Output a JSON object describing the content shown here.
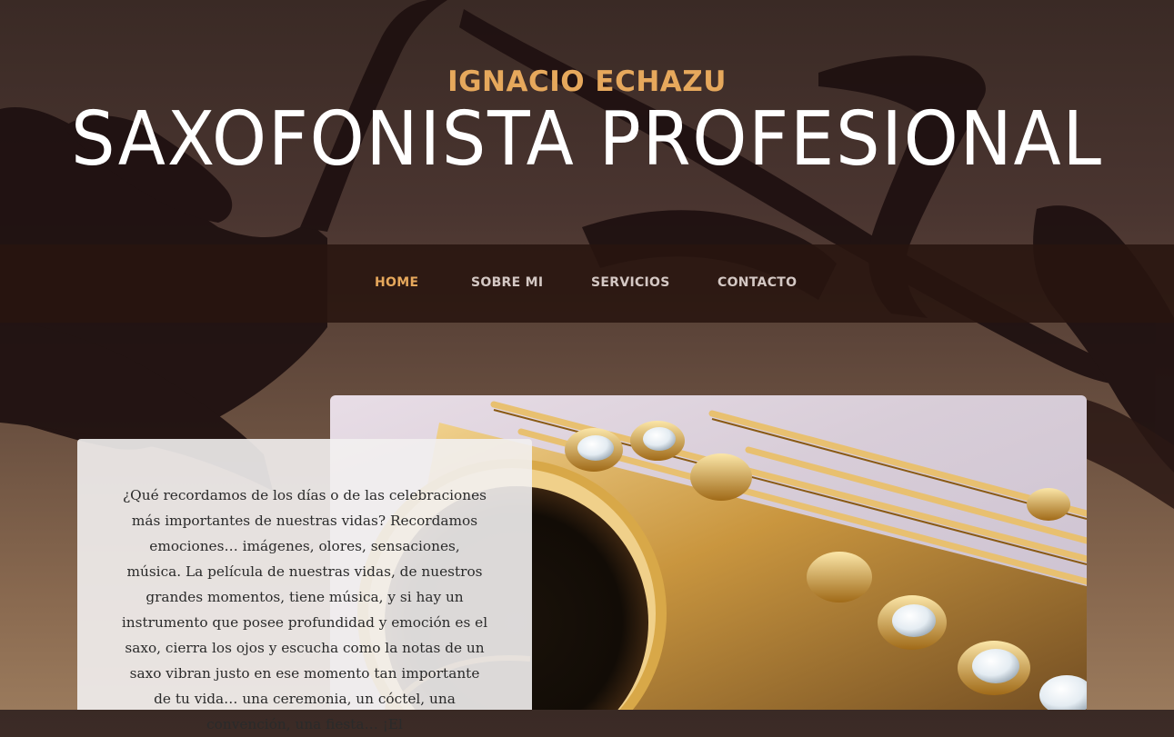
{
  "header": {
    "brand_name": "IGNACIO ECHAZU",
    "tagline": "SAXOFONISTA PROFESIONAL"
  },
  "nav": {
    "items": [
      {
        "label": "HOME",
        "active": true
      },
      {
        "label": "SOBRE MI",
        "active": false
      },
      {
        "label": "SERVICIOS",
        "active": false
      },
      {
        "label": "CONTACTO",
        "active": false
      }
    ]
  },
  "intro": {
    "text": "¿Qué recordamos de los días o de las celebraciones más importantes de nuestras vidas? Recordamos emociones… imágenes, olores, sensaciones, música. La película de nuestras vidas, de nuestros grandes momentos, tiene música, y si hay un instrumento que posee profundidad y emoción es el saxo, cierra los ojos y escucha como la notas de un saxo vibran justo en ese momento tan importante de tu vida… una ceremonia, un cóctel, una convención, una fiesta… ¡El"
  },
  "colors": {
    "accent": "#e6a85c",
    "nav_text": "#d4c8c4",
    "nav_bg": "#2a1610",
    "card_bg": "#f2f0f0",
    "body_text": "#2a2a2a"
  }
}
